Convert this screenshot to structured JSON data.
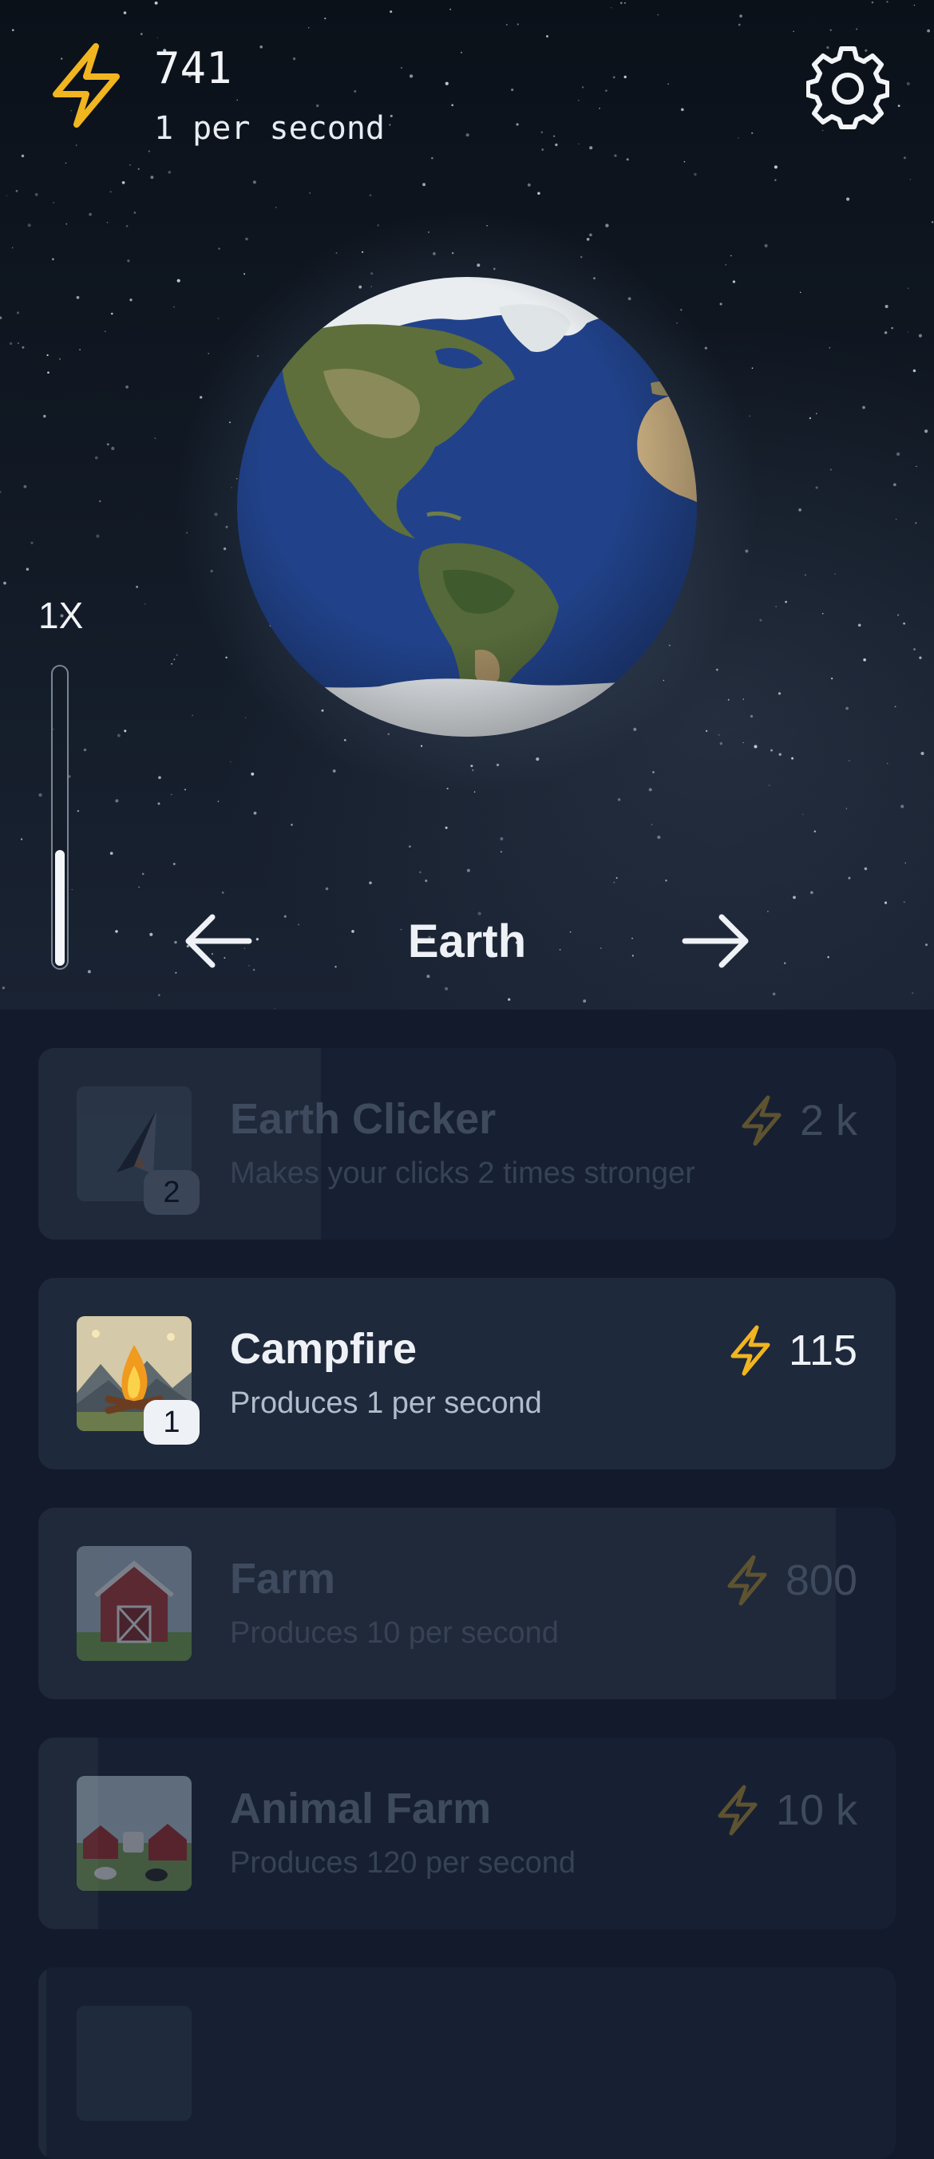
{
  "header": {
    "energy_amount": "741",
    "energy_rate": "1 per second",
    "icons": {
      "energy": "lightning-bolt-icon",
      "settings": "gear-icon"
    }
  },
  "planet": {
    "name": "Earth",
    "multiplier": "1X",
    "multiplier_level": 0.4,
    "icons": {
      "prev": "arrow-left-icon",
      "next": "arrow-right-icon"
    }
  },
  "colors": {
    "accent_bolt": "#f1b520",
    "dim_bolt": "#5e5330",
    "card_active": "#1e293b",
    "card_dim": "#172033",
    "background": "#131a2b"
  },
  "upgrades": [
    {
      "title": "Earth Clicker",
      "description": "Makes your clicks 2 times stronger",
      "price": "2 k",
      "count": "2",
      "affordable": false,
      "progress": 0.33,
      "icon": "paper-plane-icon"
    },
    {
      "title": "Campfire",
      "description": "Produces 1 per second",
      "price": "115",
      "count": "1",
      "affordable": true,
      "progress": 1.0,
      "icon": "campfire-icon"
    },
    {
      "title": "Farm",
      "description": "Produces 10 per second",
      "price": "800",
      "count": "",
      "affordable": false,
      "progress": 0.93,
      "icon": "barn-icon"
    },
    {
      "title": "Animal Farm",
      "description": "Produces 120 per second",
      "price": "10 k",
      "count": "",
      "affordable": false,
      "progress": 0.07,
      "icon": "animal-farm-icon"
    }
  ]
}
